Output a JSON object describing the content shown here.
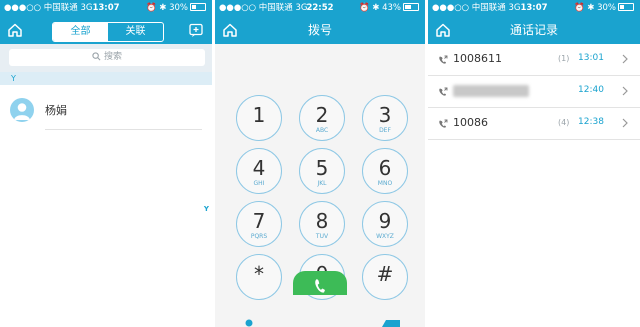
{
  "status_bars": [
    {
      "carrier": "●●●○○ 中国联通",
      "network": "3G",
      "time": "13:07",
      "battery": "30%",
      "battery_level": 0.3
    },
    {
      "carrier": "●●●○○ 中国联通",
      "network": "3G",
      "time": "22:52",
      "battery": "43%",
      "battery_level": 0.43
    },
    {
      "carrier": "●●●○○ 中国联通",
      "network": "3G",
      "time": "13:07",
      "battery": "30%",
      "battery_level": 0.3
    }
  ],
  "contacts_screen": {
    "tabs": [
      {
        "label": "全部",
        "selected": true
      },
      {
        "label": "关联",
        "selected": false
      }
    ],
    "search_placeholder": "搜索",
    "section_letter": "Y",
    "contact_name": "杨娟",
    "index_letter": "Y"
  },
  "dialer_screen": {
    "title": "拨号",
    "keys": [
      {
        "digit": "1",
        "letters": ""
      },
      {
        "digit": "2",
        "letters": "ABC"
      },
      {
        "digit": "3",
        "letters": "DEF"
      },
      {
        "digit": "4",
        "letters": "GHI"
      },
      {
        "digit": "5",
        "letters": "JKL"
      },
      {
        "digit": "6",
        "letters": "MNO"
      },
      {
        "digit": "7",
        "letters": "PQRS"
      },
      {
        "digit": "8",
        "letters": "TUV"
      },
      {
        "digit": "9",
        "letters": "WXYZ"
      },
      {
        "digit": "*",
        "letters": ""
      },
      {
        "digit": "0",
        "letters": "+"
      },
      {
        "digit": "#",
        "letters": ""
      }
    ]
  },
  "call_log_screen": {
    "title": "通话记录",
    "entries": [
      {
        "number": "1008611",
        "count": "(1)",
        "time": "13:01",
        "blurred": false
      },
      {
        "number": "",
        "count": "",
        "time": "12:40",
        "blurred": true
      },
      {
        "number": "10086",
        "count": "(4)",
        "time": "12:38",
        "blurred": false
      }
    ]
  },
  "colors": {
    "accent": "#1aa3cf",
    "call_green": "#3dbb57",
    "key_border": "#8ec8e5"
  },
  "icons": [
    "home-icon",
    "add-contact-icon",
    "search-icon",
    "phone-icon",
    "chevron-right-icon",
    "bluetooth-icon",
    "alarm-icon"
  ]
}
